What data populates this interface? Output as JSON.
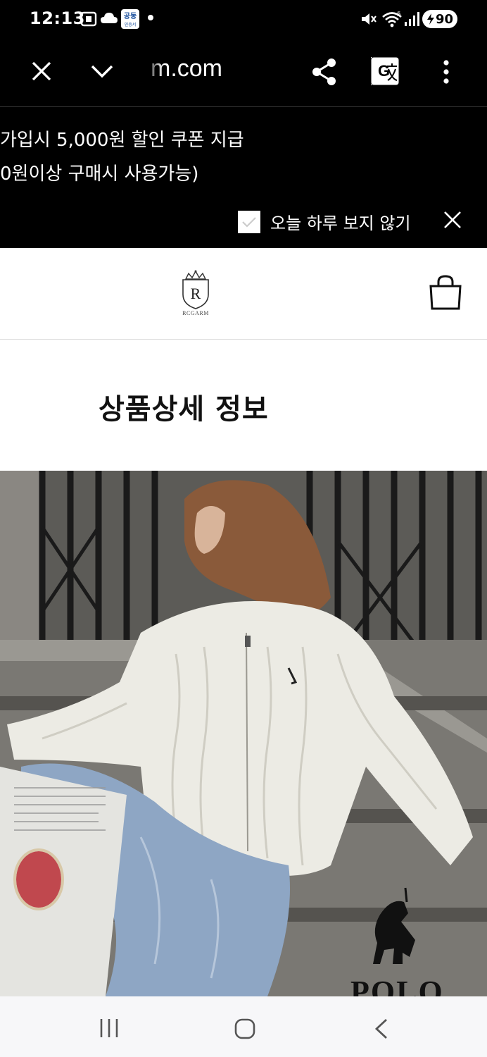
{
  "status_bar": {
    "time": "12:13",
    "notification_badge_top": "공동",
    "notification_badge_bottom": "인증서",
    "battery": "90",
    "icons": [
      "screenshot-icon",
      "cloud-icon",
      "certificate-badge-icon",
      "dot-icon",
      "mute-icon",
      "wifi-icon",
      "signal-icon",
      "battery-charging-icon"
    ]
  },
  "browser": {
    "url": "m.com",
    "icons": [
      "close-icon",
      "chevron-down-icon",
      "share-icon",
      "translate-icon",
      "more-vertical-icon"
    ]
  },
  "promo": {
    "line1": "가입시 5,000원 할인 쿠폰 지급",
    "line2": "0원이상 구매시 사용가능)",
    "hide_today_label": "오늘 하루 보지 않기",
    "hide_today_checked": true
  },
  "header": {
    "logo_initial": "R",
    "logo_text": "RCGARM",
    "cart_icon": "shopping-bag-icon"
  },
  "section": {
    "title": "상품상세 정보"
  },
  "product_image": {
    "overlay_text": "POLO"
  },
  "nav": {
    "icons": [
      "recent-apps-icon",
      "home-icon",
      "back-icon"
    ]
  },
  "colors": {
    "dark_bg": "#000000",
    "text_dark": "#111111",
    "nav_bg": "#f7f7f9"
  }
}
